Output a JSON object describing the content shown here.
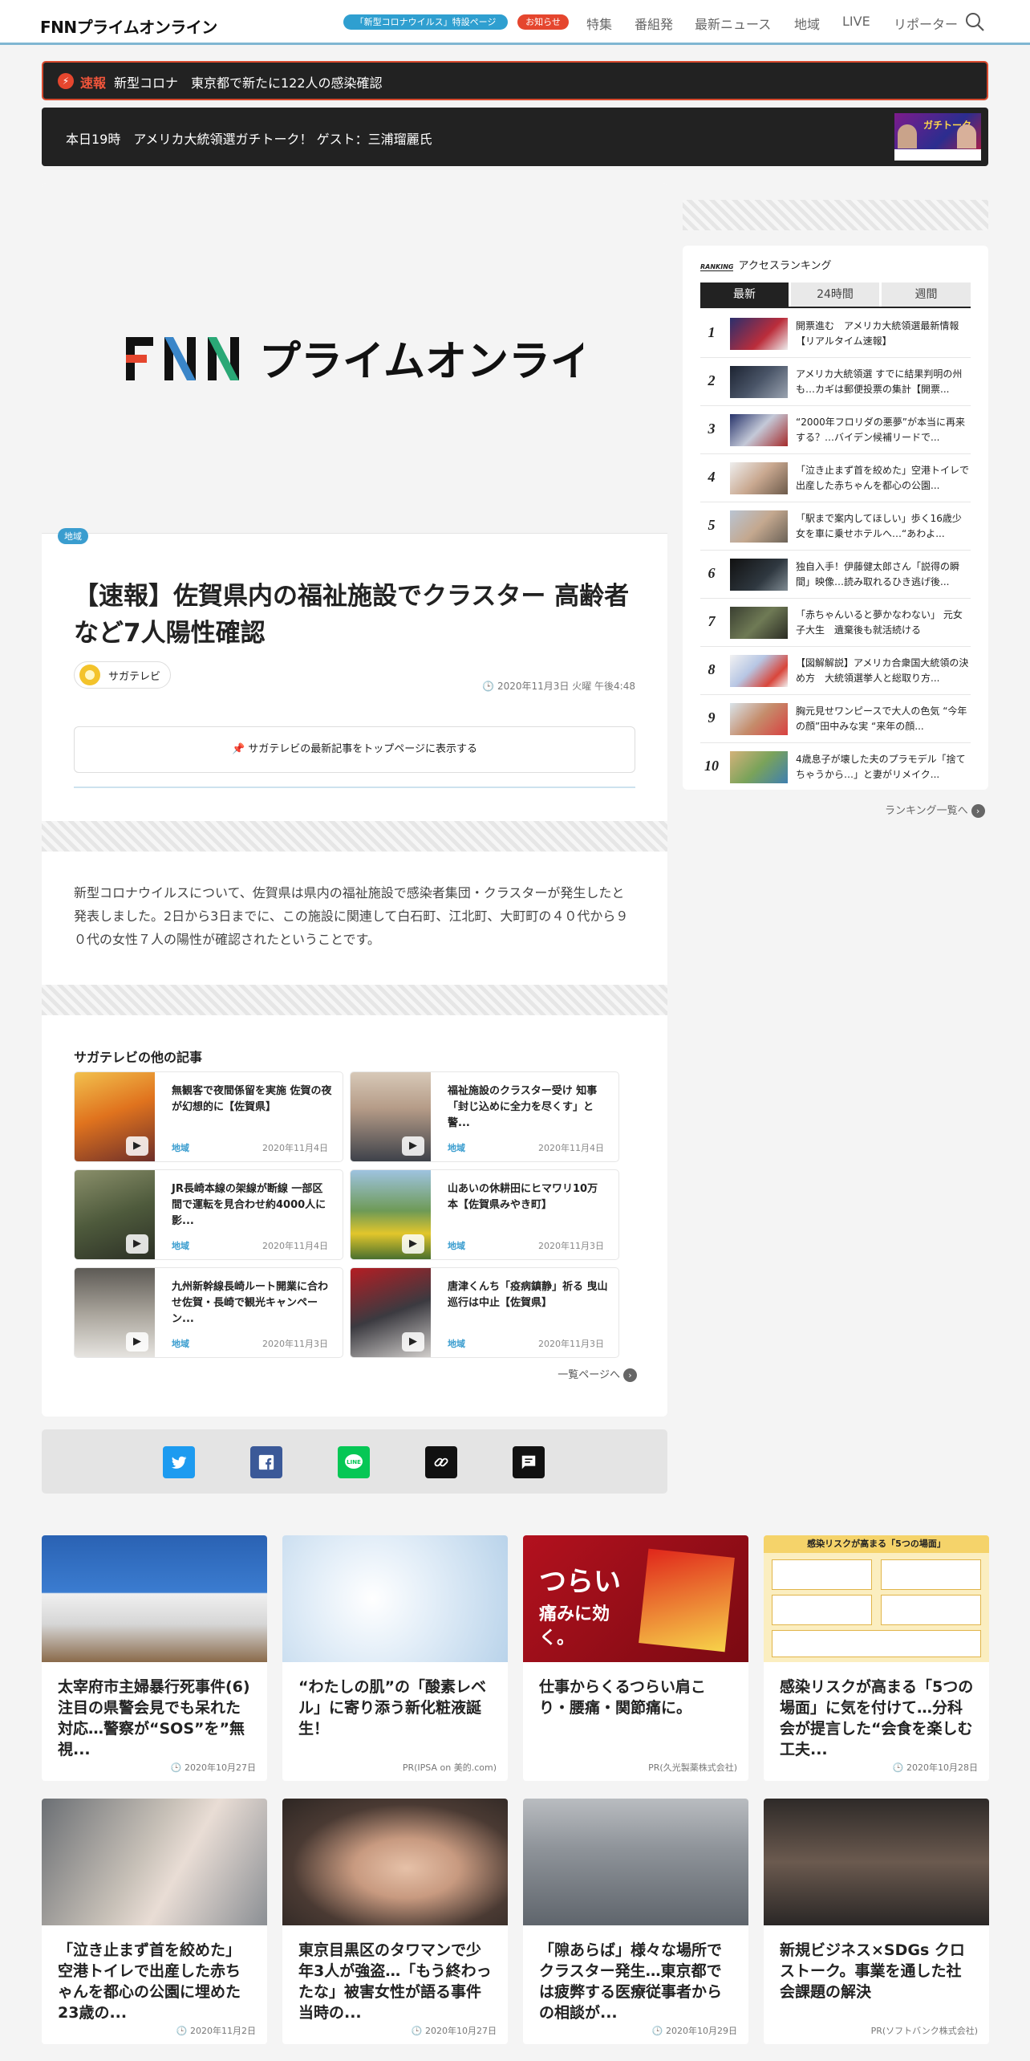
{
  "header": {
    "logo": "FNNプライムオンライン",
    "corona_pill": "「新型コロナウイルス」特設ページ",
    "notice_pill": "お知らせ",
    "nav": [
      "特集",
      "番組発",
      "最新ニュース",
      "地域",
      "LIVE",
      "リポーター"
    ]
  },
  "breaking": {
    "label": "速報",
    "text": "新型コロナ　東京都で新たに122人の感染確認"
  },
  "live_banner": {
    "text": "本日19時　アメリカ大統領選ガチトーク！ ゲスト：三浦瑠麗氏",
    "thumb_text": "ガチトーク"
  },
  "article": {
    "hero_logo": "FNNプライムオンライン",
    "region_tag": "地域",
    "title": "【速報】佐賀県内の福祉施設でクラスター 高齢者など7人陽性確認",
    "source": "サガテレビ",
    "date": "2020年11月3日 火曜 午後4:48",
    "follow_button": "サガテレビの最新記事をトップページに表示する",
    "body": "新型コロナウイルスについて、佐賀県は県内の福祉施設で感染者集団・クラスターが発生したと発表しました。2日から3日までに、この施設に関連して白石町、江北町、大町町の４０代から９０代の女性７人の陽性が確認されたということです。"
  },
  "other_articles": {
    "heading": "サガテレビの他の記事",
    "more": "一覧ページへ",
    "items": [
      {
        "title": "無観客で夜間係留を実施 佐賀の夜が幻想的に【佐賀県】",
        "region": "地域",
        "date": "2020年11月4日"
      },
      {
        "title": "福祉施設のクラスター受け 知事「封じ込めに全力を尽くす」と警...",
        "region": "地域",
        "date": "2020年11月4日"
      },
      {
        "title": "JR長崎本線の架線が断線 一部区間で運転を見合わせ約4000人に影...",
        "region": "地域",
        "date": "2020年11月4日"
      },
      {
        "title": "山あいの休耕田にヒマワリ10万本【佐賀県みやき町】",
        "region": "地域",
        "date": "2020年11月3日"
      },
      {
        "title": "九州新幹線長崎ルート開業に合わせ佐賀・長崎で観光キャンペーン...",
        "region": "地域",
        "date": "2020年11月3日"
      },
      {
        "title": "唐津くんち「疫病鎮静」祈る 曳山巡行は中止【佐賀県】",
        "region": "地域",
        "date": "2020年11月3日"
      }
    ]
  },
  "share": {
    "icons": [
      "twitter-icon",
      "facebook-icon",
      "line-icon",
      "link-icon",
      "comment-icon"
    ]
  },
  "ranking": {
    "label": "RANKING",
    "title": "アクセスランキング",
    "tabs": [
      "最新",
      "24時間",
      "週間"
    ],
    "active_tab": "最新",
    "more": "ランキング一覧へ",
    "items": [
      {
        "rank": "1",
        "title": "開票進む　アメリカ大統領選最新情報【リアルタイム速報】"
      },
      {
        "rank": "2",
        "title": "アメリカ大統領選 すでに結果判明の州も…カギは郵便投票の集計【開票..."
      },
      {
        "rank": "3",
        "title": "“2000年フロリダの悪夢”が本当に再来する？…バイデン候補リードで..."
      },
      {
        "rank": "4",
        "title": "「泣き止まず首を絞めた」空港トイレで出産した赤ちゃんを都心の公園..."
      },
      {
        "rank": "5",
        "title": "「駅まで案内してほしい」歩く16歳少女を車に乗せホテルへ…“あわよ..."
      },
      {
        "rank": "6",
        "title": "独自入手！伊藤健太郎さん「説得の瞬間」映像…読み取れるひき逃げ後..."
      },
      {
        "rank": "7",
        "title": "「赤ちゃんいると夢かなわない」 元女子大生　遺棄後も就活続ける"
      },
      {
        "rank": "8",
        "title": "【図解解説】アメリカ合衆国大統領の決め方　大統領選挙人と総取り方..."
      },
      {
        "rank": "9",
        "title": "胸元見せワンピースで大人の色気 “今年の顔”田中みな実 “来年の顔..."
      },
      {
        "rank": "10",
        "title": "4歳息子が壊した夫のプラモデル「捨てちゃうから…」と妻がリメイク..."
      }
    ]
  },
  "bottom_cards": [
    {
      "title": "太宰府市主婦暴行死事件(6)注目の県警会見でも呆れた対応…警察が“SOS”を”無視...",
      "meta": "2020年10月27日"
    },
    {
      "title": "“わたしの肌”の「酸素レベル」に寄り添う新化粧液誕生！",
      "meta": "PR(IPSA on 美的.com)"
    },
    {
      "title": "仕事からくるつらい肩こり・腰痛・関節痛に。",
      "meta": "PR(久光製薬株式会社)",
      "thumb_text_1": "つらい",
      "thumb_text_2": "痛みに効く。"
    },
    {
      "title": "感染リスクが高まる「5つの場面」に気を付けて…分科会が提言した“会食を楽しむ工夫...",
      "meta": "2020年10月28日",
      "thumb_text": "感染リスクが高まる「5つの場面」"
    },
    {
      "title": "「泣き止まず首を絞めた」空港トイレで出産した赤ちゃんを都心の公園に埋めた23歳の...",
      "meta": "2020年11月2日"
    },
    {
      "title": "東京目黒区のタワマンで少年3人が強盗…「もう終わったな」被害女性が語る事件当時の...",
      "meta": "2020年10月27日"
    },
    {
      "title": "「隙あらば」様々な場所でクラスター発生…東京都では疲弊する医療従事者からの相談が...",
      "meta": "2020年10月29日"
    },
    {
      "title": "新規ビジネス×SDGs クロストーク。事業を通した社会課題の解決",
      "meta": "PR(ソフトバンク株式会社)"
    }
  ]
}
